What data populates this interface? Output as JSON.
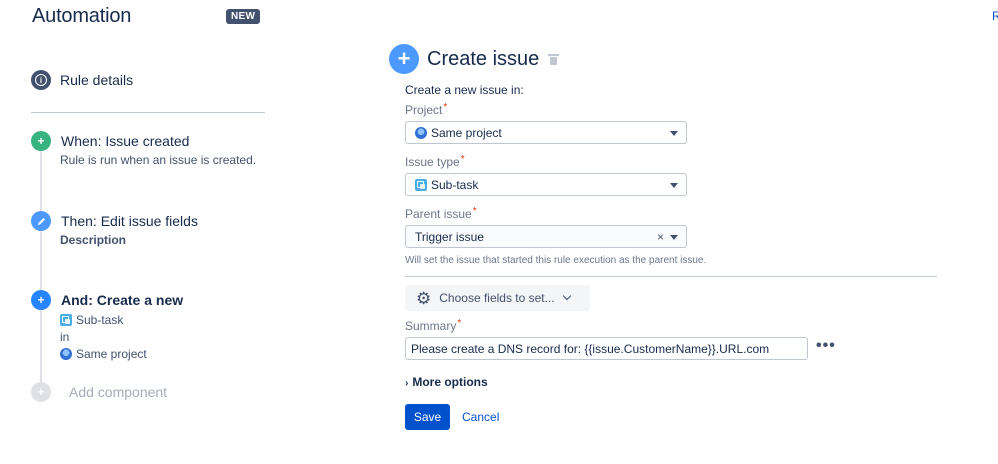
{
  "header": {
    "title": "Automation",
    "badge": "NEW",
    "edge_text": "R"
  },
  "sidebar": {
    "rule_details": "Rule details",
    "steps": [
      {
        "title": "When: Issue created",
        "sub": "Rule is run when an issue is created."
      },
      {
        "title": "Then: Edit issue fields",
        "sub": "Description"
      },
      {
        "title": "And: Create a new",
        "line1": "Sub-task",
        "line2": "in",
        "line3": "Same project"
      }
    ],
    "add_component": "Add component"
  },
  "panel": {
    "title": "Create issue",
    "intro": "Create a new issue in:",
    "project": {
      "label": "Project",
      "value": "Same project"
    },
    "issue_type": {
      "label": "Issue type",
      "value": "Sub-task"
    },
    "parent_issue": {
      "label": "Parent issue",
      "value": "Trigger issue",
      "hint": "Will set the issue that started this rule execution as the parent issue."
    },
    "choose_fields": "Choose fields to set...",
    "summary": {
      "label": "Summary",
      "value": "Please create a DNS record for: {{issue.CustomerName}}.URL.com"
    },
    "more_options": "More options",
    "save": "Save",
    "cancel": "Cancel",
    "required_mark": "*"
  },
  "colors": {
    "primary": "#0052cc",
    "success": "#36b37e",
    "info": "#4c9aff",
    "required": "#de350b"
  }
}
